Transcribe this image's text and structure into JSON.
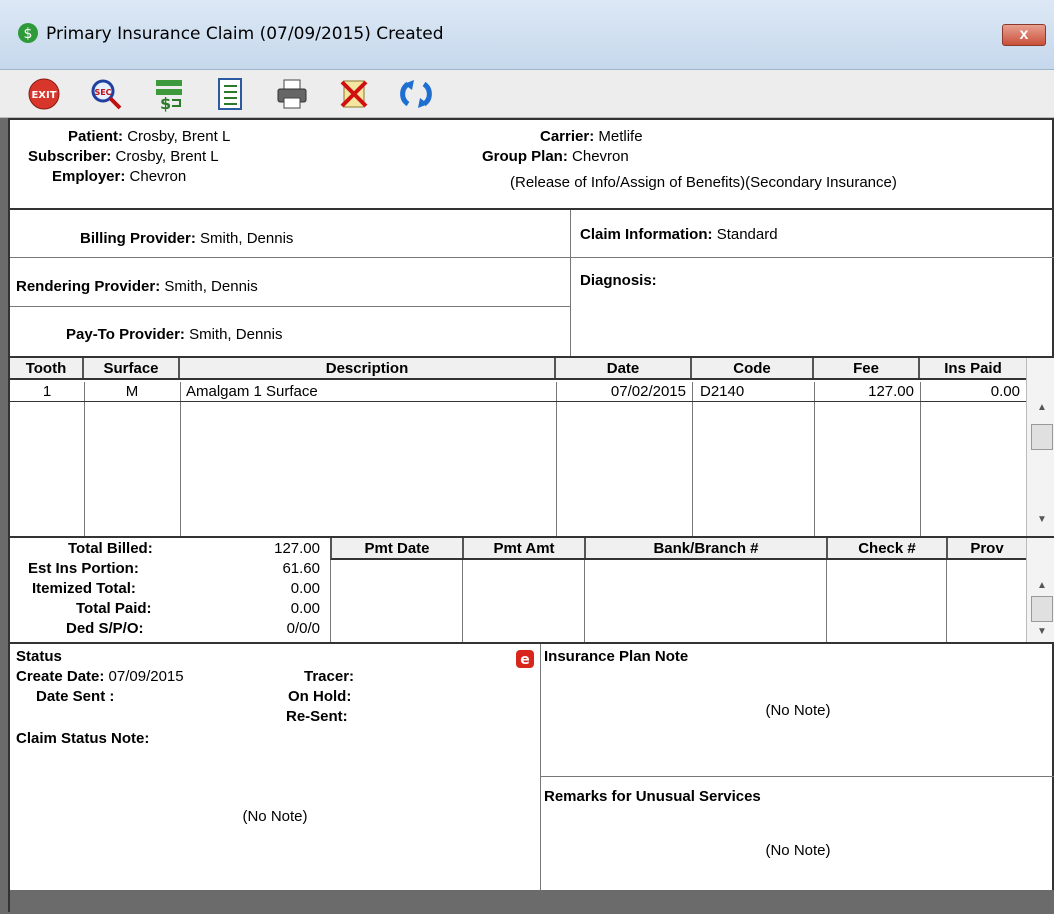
{
  "window": {
    "title": "Primary Insurance Claim (07/09/2015) Created",
    "close_label": "x"
  },
  "toolbar": [
    {
      "icon": "exit-icon",
      "label": "EXIT"
    },
    {
      "icon": "search-icon",
      "label": "SEC"
    },
    {
      "icon": "payment-icon",
      "label": ""
    },
    {
      "icon": "list-icon",
      "label": ""
    },
    {
      "icon": "printer-icon",
      "label": ""
    },
    {
      "icon": "delete-icon",
      "label": ""
    },
    {
      "icon": "refresh-icon",
      "label": ""
    }
  ],
  "patient_info": {
    "patient_label": "Patient:",
    "patient_value": "Crosby, Brent L",
    "subscriber_label": "Subscriber:",
    "subscriber_value": "Crosby, Brent L",
    "employer_label": "Employer:",
    "employer_value": "Chevron",
    "carrier_label": "Carrier:",
    "carrier_value": "Metlife",
    "group_plan_label": "Group Plan:",
    "group_plan_value": "Chevron",
    "release_text": "(Release of Info/Assign of Benefits)(Secondary Insurance)"
  },
  "providers": {
    "billing_label": "Billing Provider:",
    "billing_value": "Smith, Dennis",
    "rendering_label": "Rendering Provider:",
    "rendering_value": "Smith, Dennis",
    "payto_label": "Pay-To Provider:",
    "payto_value": "Smith, Dennis",
    "claim_info_label": "Claim Information:",
    "claim_info_value": "Standard",
    "diagnosis_label": "Diagnosis:"
  },
  "procedures": {
    "headers": [
      "Tooth",
      "Surface",
      "Description",
      "Date",
      "Code",
      "Fee",
      "Ins Paid"
    ],
    "rows": [
      {
        "tooth": "1",
        "surface": "M",
        "description": "Amalgam 1 Surface",
        "date": "07/02/2015",
        "code": "D2140",
        "fee": "127.00",
        "ins_paid": "0.00"
      }
    ]
  },
  "totals": {
    "total_billed_label": "Total Billed:",
    "total_billed": "127.00",
    "est_ins_label": "Est Ins Portion:",
    "est_ins": "61.60",
    "itemized_label": "Itemized Total:",
    "itemized": "0.00",
    "total_paid_label": "Total Paid:",
    "total_paid": "0.00",
    "ded_label": "Ded S/P/O:",
    "ded": "0/0/0"
  },
  "payments": {
    "headers": [
      "Pmt Date",
      "Pmt Amt",
      "Bank/Branch #",
      "Check #",
      "Prov"
    ]
  },
  "status": {
    "title": "Status",
    "create_date_label": "Create Date:",
    "create_date": "07/09/2015",
    "tracer_label": "Tracer:",
    "date_sent_label": "Date Sent :",
    "on_hold_label": "On Hold:",
    "resent_label": "Re-Sent:",
    "claim_note_label": "Claim Status Note:",
    "claim_note": "(No Note)"
  },
  "notes": {
    "plan_note_label": "Insurance Plan Note",
    "plan_note": "(No Note)",
    "remarks_label": "Remarks for Unusual Services",
    "remarks": "(No Note)"
  }
}
